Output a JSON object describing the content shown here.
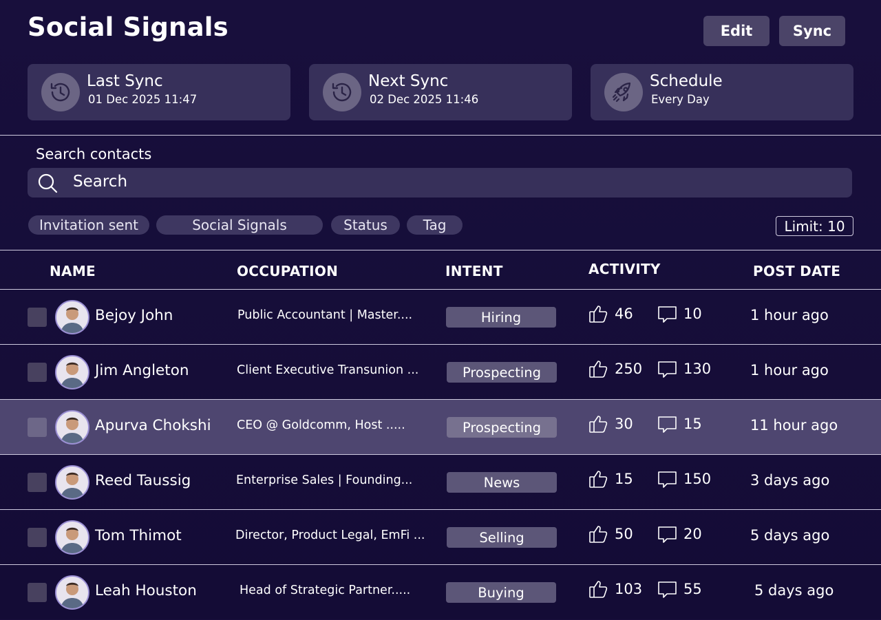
{
  "header": {
    "title": "Social Signals",
    "edit_label": "Edit",
    "sync_label": "Sync"
  },
  "cards": [
    {
      "title": "Last Sync",
      "value": "01 Dec 2025 11:47",
      "icon": "history-icon"
    },
    {
      "title": "Next Sync",
      "value": "02 Dec 2025 11:46",
      "icon": "history-icon"
    },
    {
      "title": "Schedule",
      "value": "Every Day",
      "icon": "rocket-icon"
    }
  ],
  "search": {
    "label": "Search contacts",
    "placeholder": "Search"
  },
  "filters": [
    "Invitation sent",
    "Social Signals",
    "Status",
    "Tag"
  ],
  "limit": "Limit: 10",
  "columns": {
    "name": "NAME",
    "occupation": "OCCUPATION",
    "intent": "INTENT",
    "activity": "ACTIVITY",
    "post_date": "POST DATE"
  },
  "rows": [
    {
      "name": "Bejoy John",
      "occupation": "Public Accountant | Master....",
      "intent": "Hiring",
      "likes": "46",
      "comments": "10",
      "post_date": "1 hour ago"
    },
    {
      "name": "Jim Angleton",
      "occupation": "Client Executive Transunion ...",
      "intent": "Prospecting",
      "likes": "250",
      "comments": "130",
      "post_date": "1 hour ago"
    },
    {
      "name": "Apurva Chokshi",
      "occupation": "CEO @ Goldcomm, Host .....",
      "intent": "Prospecting",
      "likes": "30",
      "comments": "15",
      "post_date": "11 hour ago",
      "selected": true
    },
    {
      "name": "Reed Taussig",
      "occupation": "Enterprise Sales | Founding...",
      "intent": "News",
      "likes": "15",
      "comments": "150",
      "post_date": "3 days ago"
    },
    {
      "name": "Tom Thimot",
      "occupation": "Director, Product Legal, EmFi ...",
      "intent": "Selling",
      "likes": "50",
      "comments": "20",
      "post_date": "5 days ago"
    },
    {
      "name": "Leah Houston",
      "occupation": "Head of Strategic Partner.....",
      "intent": "Buying",
      "likes": "103",
      "comments": "55",
      "post_date": "5 days ago"
    }
  ],
  "colors": {
    "background": "#180f3c",
    "card": "#37305a",
    "selected_row": "#4e4670",
    "intent_badge": "#5c5678"
  }
}
